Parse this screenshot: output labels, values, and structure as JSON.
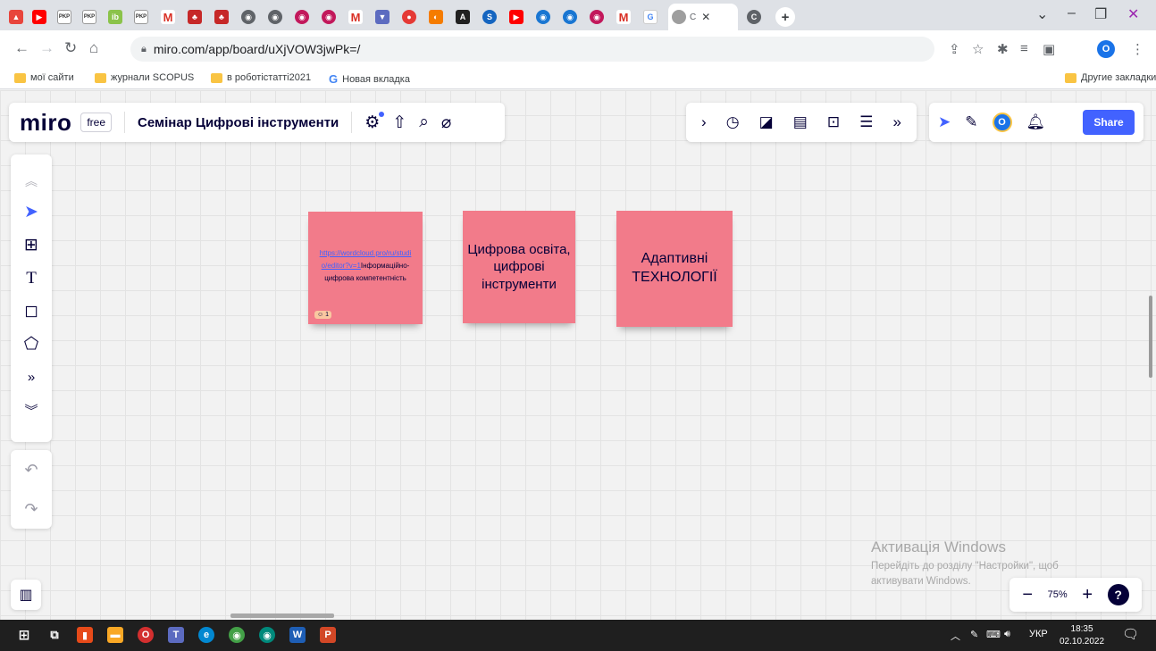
{
  "browser": {
    "active_tab_title": "C",
    "url": "miro.com/app/board/uXjVOW3jwPk=/",
    "new_tab_label": "+",
    "tabs": [
      {
        "icon": "pkr-icon",
        "label": "PKP"
      },
      {
        "icon": "pkr-icon",
        "label": "PKP"
      },
      {
        "icon": "pkr-icon",
        "label": "PKP"
      },
      {
        "icon": "gmail-icon",
        "label": "M"
      },
      {
        "icon": "gmail-icon",
        "label": "M"
      },
      {
        "icon": "gmail-icon",
        "label": "M"
      },
      {
        "icon": "zoom-icon",
        "label": "S"
      },
      {
        "icon": "chrome-icon",
        "label": "C"
      }
    ]
  },
  "bookmarks": [
    {
      "label": "мої сайти",
      "icon": "folder-icon"
    },
    {
      "label": "журнали SCOPUS",
      "icon": "folder-icon"
    },
    {
      "label": "в роботістатті2021",
      "icon": "folder-icon"
    },
    {
      "label": "Новая вкладка",
      "icon": "google-icon"
    }
  ],
  "bookmarks_other": "Другие закладки",
  "profile_initial": "O",
  "miro": {
    "logo": "miro",
    "plan": "free",
    "board_title": "Семінар Цифрові інструменти",
    "share_label": "Share",
    "avatar_initial": "O",
    "zoom_level": "75%",
    "zoom_minus": "−",
    "zoom_plus": "+",
    "help": "?"
  },
  "stickies": [
    {
      "link": "https://wordcloud.pro/ru/studio/editor?v=1",
      "text": "Інформаційно-цифрова компетентність",
      "reaction": "1",
      "color": "#f27b8a"
    },
    {
      "text": "Цифрова освіта, цифрові інструменти",
      "color": "#f27b8a"
    },
    {
      "text": "Адаптивні ТЕХНОЛОГІЇ",
      "color": "#f27b8a"
    }
  ],
  "windows_activation": {
    "title": "Активація Windows",
    "line1": "Перейдіть до розділу \"Настройки\", щоб",
    "line2": "активувати Windows."
  },
  "taskbar": {
    "language": "УКР",
    "time": "18:35",
    "date": "02.10.2022"
  },
  "colors": {
    "miro_blue": "#4262ff",
    "sticky_pink": "#f27b8a",
    "miro_dark": "#050038"
  }
}
